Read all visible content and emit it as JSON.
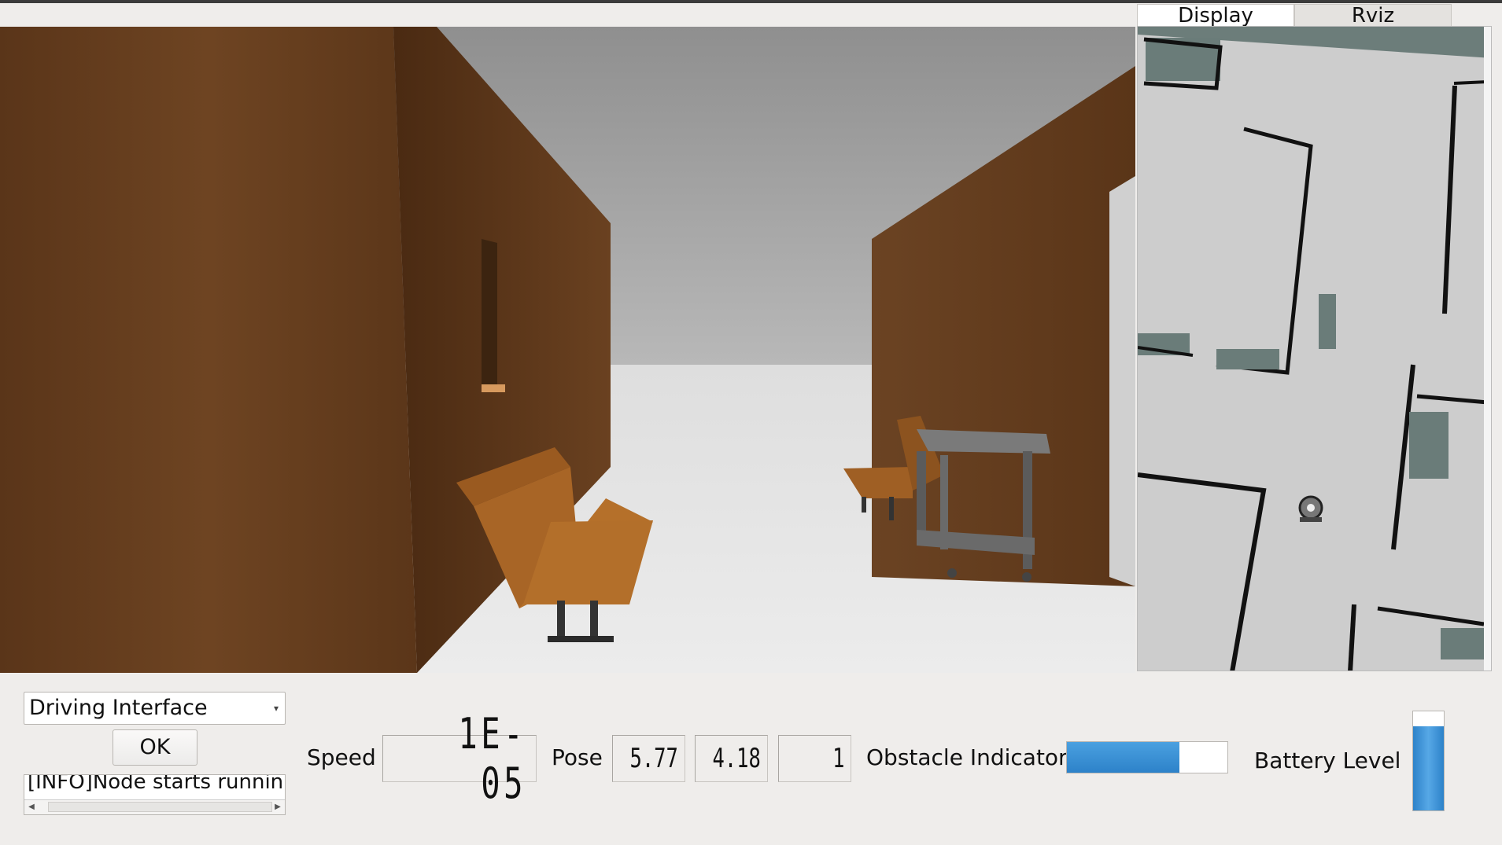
{
  "tabs": [
    {
      "label": "Display",
      "active": true
    },
    {
      "label": "Rviz",
      "active": false
    }
  ],
  "controls": {
    "mode_select": {
      "value": "Driving Interface"
    },
    "ok_label": "OK",
    "log_text": "[INFO]Node starts runnin"
  },
  "speed": {
    "label": "Speed",
    "value": "1E-05"
  },
  "pose": {
    "label": "Pose",
    "x": "5.77",
    "y": "4.18",
    "theta": "1"
  },
  "obstacle": {
    "label": "Obstacle Indicator",
    "level": 0.7
  },
  "battery": {
    "label": "Battery Level",
    "level": 0.85
  },
  "colors": {
    "accent": "#2d82c9",
    "background": "#efedeb",
    "wood": "#6b4020",
    "floor": "#e3e3e3"
  },
  "icons": {
    "dropdown": "chevron-down-icon",
    "scroll_left": "scroll-left-icon",
    "scroll_right": "scroll-right-icon"
  }
}
